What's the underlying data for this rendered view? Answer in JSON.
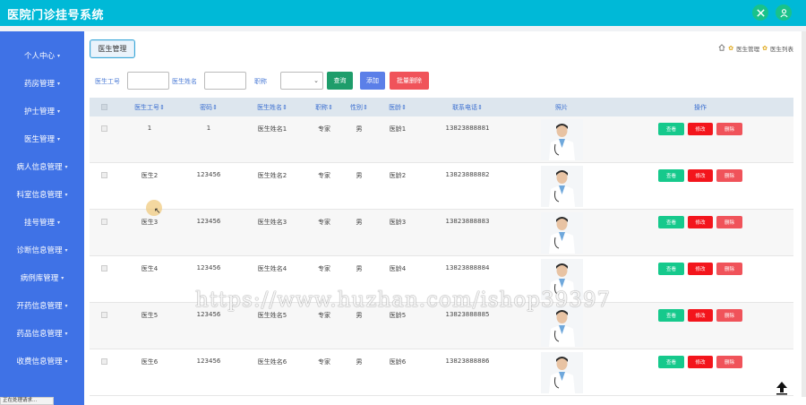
{
  "app": {
    "title": "医院门诊挂号系统"
  },
  "header": {
    "icons": [
      "swap-icon",
      "user-icon"
    ]
  },
  "sidebar": {
    "items": [
      {
        "label": "个人中心",
        "chevron": true
      },
      {
        "label": "药房管理",
        "chevron": true
      },
      {
        "label": "护士管理",
        "chevron": true
      },
      {
        "label": "医生管理",
        "chevron": true
      },
      {
        "label": "病人信息管理",
        "chevron": true
      },
      {
        "label": "科室信息管理",
        "chevron": true
      },
      {
        "label": "挂号管理",
        "chevron": true
      },
      {
        "label": "诊断信息管理",
        "chevron": true
      },
      {
        "label": "病例库管理",
        "chevron": true
      },
      {
        "label": "开药信息管理",
        "chevron": true
      },
      {
        "label": "药品信息管理",
        "chevron": true
      },
      {
        "label": "收费信息管理",
        "chevron": true
      }
    ]
  },
  "tab": {
    "label": "医生管理"
  },
  "breadcrumb": {
    "home_icon": "home-icon",
    "items": [
      "医生管理",
      "医生列表"
    ]
  },
  "search": {
    "doctor_id_label": "医生工号",
    "doctor_id_value": "",
    "doctor_name_label": "医生姓名",
    "doctor_name_value": "",
    "title_label": "职称",
    "title_value": "",
    "query_button": "查询",
    "add_button": "添加",
    "batch_delete_button": "批量删除"
  },
  "colors": {
    "header": "#00b9d7",
    "sidebar": "#3f72e6",
    "query": "#1e9d6b",
    "add": "#5b7fe8",
    "delete": "#f0535a",
    "view": "#16c98c",
    "edit": "#f3151c"
  },
  "table": {
    "columns": [
      "医生工号",
      "密码",
      "医生姓名",
      "职称",
      "性别",
      "医龄",
      "联系电话",
      "照片",
      "操作"
    ],
    "rows": [
      {
        "id": "1",
        "password": "1",
        "name": "医生姓名1",
        "title": "专家",
        "gender": "男",
        "age": "医龄1",
        "phone": "13823888881"
      },
      {
        "id": "医生2",
        "password": "123456",
        "name": "医生姓名2",
        "title": "专家",
        "gender": "男",
        "age": "医龄2",
        "phone": "13823888882"
      },
      {
        "id": "医生3",
        "password": "123456",
        "name": "医生姓名3",
        "title": "专家",
        "gender": "男",
        "age": "医龄3",
        "phone": "13823888883"
      },
      {
        "id": "医生4",
        "password": "123456",
        "name": "医生姓名4",
        "title": "专家",
        "gender": "男",
        "age": "医龄4",
        "phone": "13823888884"
      },
      {
        "id": "医生5",
        "password": "123456",
        "name": "医生姓名5",
        "title": "专家",
        "gender": "男",
        "age": "医龄5",
        "phone": "13823888885"
      },
      {
        "id": "医生6",
        "password": "123456",
        "name": "医生姓名6",
        "title": "专家",
        "gender": "男",
        "age": "医龄6",
        "phone": "13823888886"
      }
    ],
    "actions": {
      "view": "查看",
      "edit": "修改",
      "delete": "删除"
    }
  },
  "watermark": "https://www.huzhan.com/ishop39397",
  "status_bar": "正在处理请求..."
}
